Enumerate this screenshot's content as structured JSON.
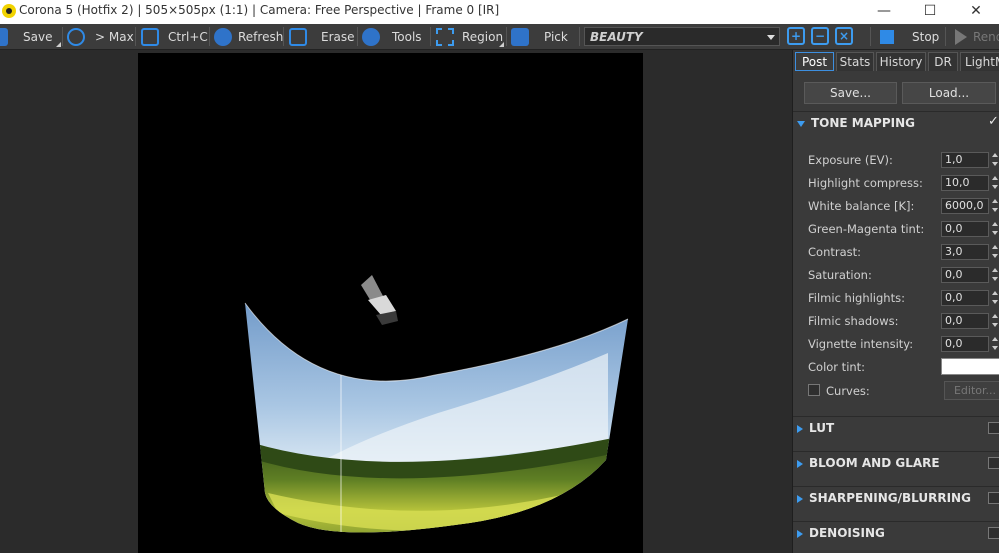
{
  "window": {
    "title": "Corona 5 (Hotfix 2) | 505×505px (1:1) | Camera: Free Perspective | Frame 0 [IR]",
    "minimize": "—",
    "maximize": "☐",
    "close": "✕"
  },
  "toolbar": {
    "save": "Save",
    "to_max": "> Max",
    "copy": "Ctrl+C",
    "refresh": "Refresh",
    "erase": "Erase",
    "tools": "Tools",
    "region": "Region",
    "pick": "Pick",
    "pass": "BEAUTY",
    "zoom_in": "+",
    "zoom_out": "−",
    "zoom_fit": "×",
    "stop": "Stop",
    "render": "Render"
  },
  "panel": {
    "tabs": [
      "Post",
      "Stats",
      "History",
      "DR",
      "LightMix"
    ],
    "active_tab": "Post",
    "save_btn": "Save...",
    "load_btn": "Load...",
    "tone_mapping": {
      "title": "TONE MAPPING",
      "enabled_mark": "✓",
      "params": [
        {
          "label": "Exposure (EV):",
          "value": "1,0"
        },
        {
          "label": "Highlight compress:",
          "value": "10,0"
        },
        {
          "label": "White balance [K]:",
          "value": "6000,0"
        },
        {
          "label": "Green-Magenta tint:",
          "value": "0,0"
        },
        {
          "label": "Contrast:",
          "value": "3,0"
        },
        {
          "label": "Saturation:",
          "value": "0,0"
        },
        {
          "label": "Filmic highlights:",
          "value": "0,0"
        },
        {
          "label": "Filmic shadows:",
          "value": "0,0"
        },
        {
          "label": "Vignette intensity:",
          "value": "0,0"
        }
      ],
      "color_tint_label": "Color tint:",
      "color_tint_value": "#ffffff",
      "curves_label": "Curves:",
      "editor_btn": "Editor..."
    },
    "sections": [
      "LUT",
      "BLOOM AND GLARE",
      "SHARPENING/BLURRING",
      "DENOISING"
    ]
  },
  "colors": {
    "accent": "#3d9cf0",
    "background": "#2b2b2b",
    "panel": "#3a3a3a"
  }
}
